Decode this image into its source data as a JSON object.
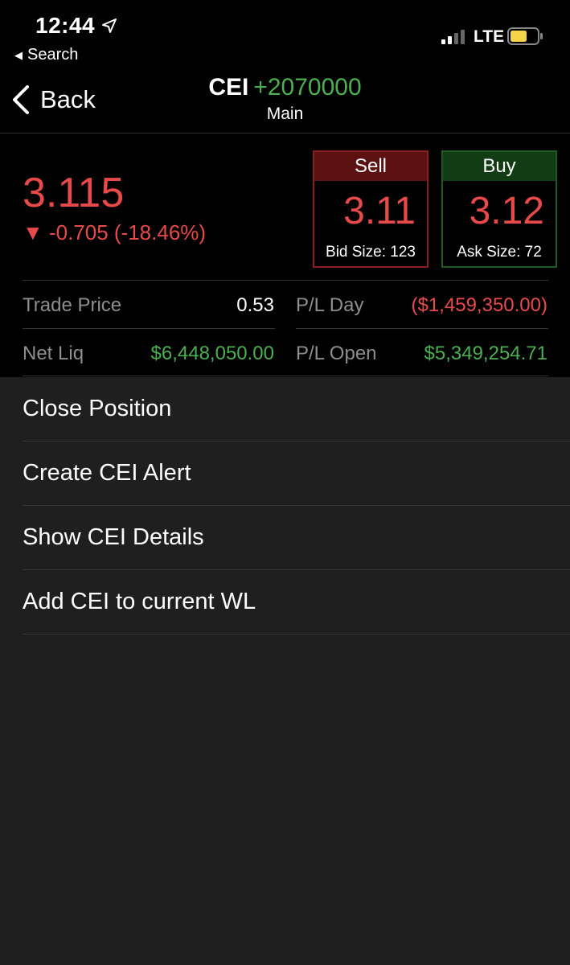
{
  "status_bar": {
    "time": "12:44",
    "back_to_app": "Search",
    "network": "LTE",
    "location_icon": "location-arrow-icon",
    "signal_icon": "cell-signal-icon",
    "battery_icon": "battery-icon",
    "battery_color": "#f5d547"
  },
  "nav": {
    "back_label": "Back",
    "symbol": "CEI",
    "position": "+2070000",
    "account": "Main"
  },
  "quote": {
    "last": "3.115",
    "change": "▼ -0.705 (-18.46%)",
    "sell": {
      "label": "Sell",
      "price": "3.11",
      "size_text": "Bid Size: 123"
    },
    "buy": {
      "label": "Buy",
      "price": "3.12",
      "size_text": "Ask Size: 72"
    }
  },
  "stats": {
    "trade_price_label": "Trade Price",
    "trade_price": "0.53",
    "pl_day_label": "P/L Day",
    "pl_day": "($1,459,350.00)",
    "net_liq_label": "Net Liq",
    "net_liq": "$6,448,050.00",
    "pl_open_label": "P/L Open",
    "pl_open": "$5,349,254.71"
  },
  "menu": [
    {
      "label": "Close Position"
    },
    {
      "label": "Create CEI Alert"
    },
    {
      "label": "Show CEI Details"
    },
    {
      "label": "Add CEI to current WL"
    }
  ],
  "colors": {
    "up": "#4caf50",
    "down": "#e84a4a",
    "sell_header": "#5c1212",
    "buy_header": "#123c14"
  }
}
